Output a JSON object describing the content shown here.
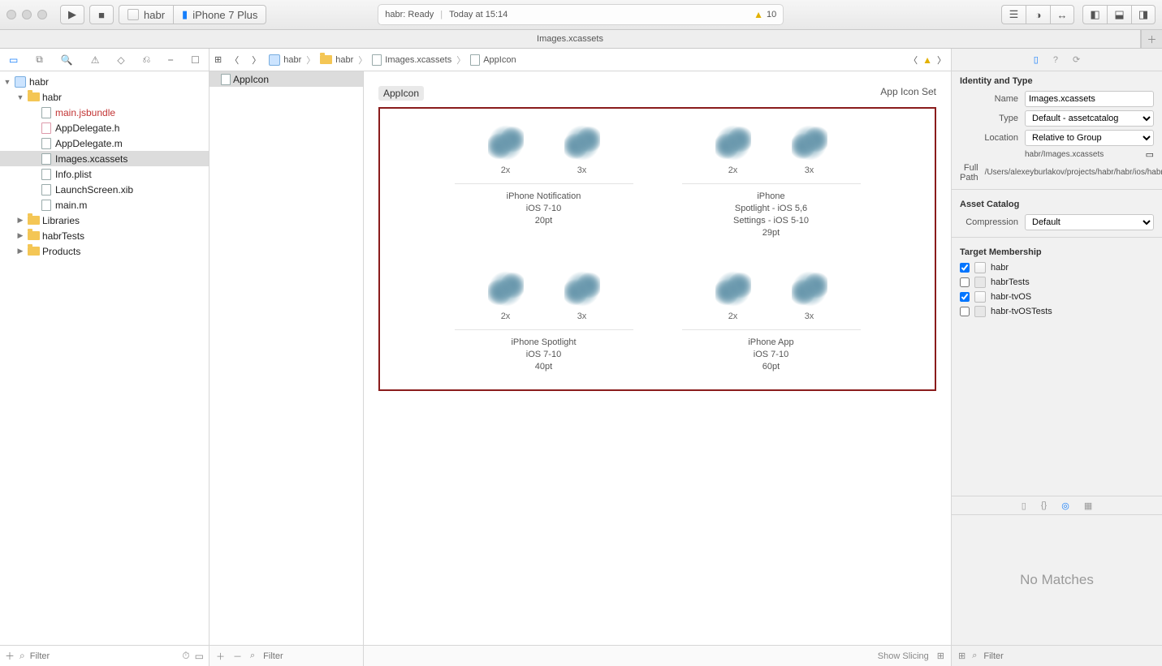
{
  "toolbar": {
    "scheme_target": "habr",
    "scheme_device": "iPhone 7 Plus",
    "status_title": "habr: Ready",
    "status_time": "Today at 15:14",
    "warn_count": "10"
  },
  "tabbar": {
    "tab": "Images.xcassets"
  },
  "nav": {
    "root": "habr",
    "group": "habr",
    "files": [
      {
        "name": "main.jsbundle",
        "kind": "red"
      },
      {
        "name": "AppDelegate.h",
        "kind": "h"
      },
      {
        "name": "AppDelegate.m",
        "kind": "m"
      },
      {
        "name": "Images.xcassets",
        "kind": "asset",
        "selected": true
      },
      {
        "name": "Info.plist",
        "kind": "plist"
      },
      {
        "name": "LaunchScreen.xib",
        "kind": "xib"
      },
      {
        "name": "main.m",
        "kind": "m"
      }
    ],
    "folders": [
      "Libraries",
      "habrTests",
      "Products"
    ],
    "filter_placeholder": "Filter"
  },
  "crumb": {
    "p1": "habr",
    "p2": "habr",
    "p3": "Images.xcassets",
    "p4": "AppIcon"
  },
  "asset_list": {
    "item": "AppIcon",
    "filter_placeholder": "Filter",
    "show_slicing": "Show Slicing"
  },
  "set": {
    "name": "AppIcon",
    "kind": "App Icon Set",
    "groups": [
      {
        "scales": [
          "2x",
          "3x"
        ],
        "lines": [
          "iPhone Notification",
          "iOS 7-10",
          "20pt"
        ]
      },
      {
        "scales": [
          "2x",
          "3x"
        ],
        "lines": [
          "iPhone",
          "Spotlight - iOS 5,6",
          "Settings - iOS 5-10",
          "29pt"
        ]
      },
      {
        "scales": [
          "2x",
          "3x"
        ],
        "lines": [
          "iPhone Spotlight",
          "iOS 7-10",
          "40pt"
        ]
      },
      {
        "scales": [
          "2x",
          "3x"
        ],
        "lines": [
          "iPhone App",
          "iOS 7-10",
          "60pt"
        ]
      }
    ]
  },
  "insp": {
    "identity_h": "Identity and Type",
    "name_label": "Name",
    "name_value": "Images.xcassets",
    "type_label": "Type",
    "type_value": "Default - assetcatalog",
    "loc_label": "Location",
    "loc_value": "Relative to Group",
    "loc_sub": "habr/Images.xcassets",
    "full_label": "Full Path",
    "full_value": "/Users/alexeyburlakov/projects/habr/habr/ios/habr/Images.xcassets",
    "catalog_h": "Asset Catalog",
    "comp_label": "Compression",
    "comp_value": "Default",
    "tm_h": "Target Membership",
    "tm": [
      {
        "label": "habr",
        "checked": true,
        "kind": "app"
      },
      {
        "label": "habrTests",
        "checked": false,
        "kind": "fold"
      },
      {
        "label": "habr-tvOS",
        "checked": true,
        "kind": "app"
      },
      {
        "label": "habr-tvOSTests",
        "checked": false,
        "kind": "fold"
      }
    ],
    "no_matches": "No Matches",
    "filter_placeholder": "Filter"
  }
}
